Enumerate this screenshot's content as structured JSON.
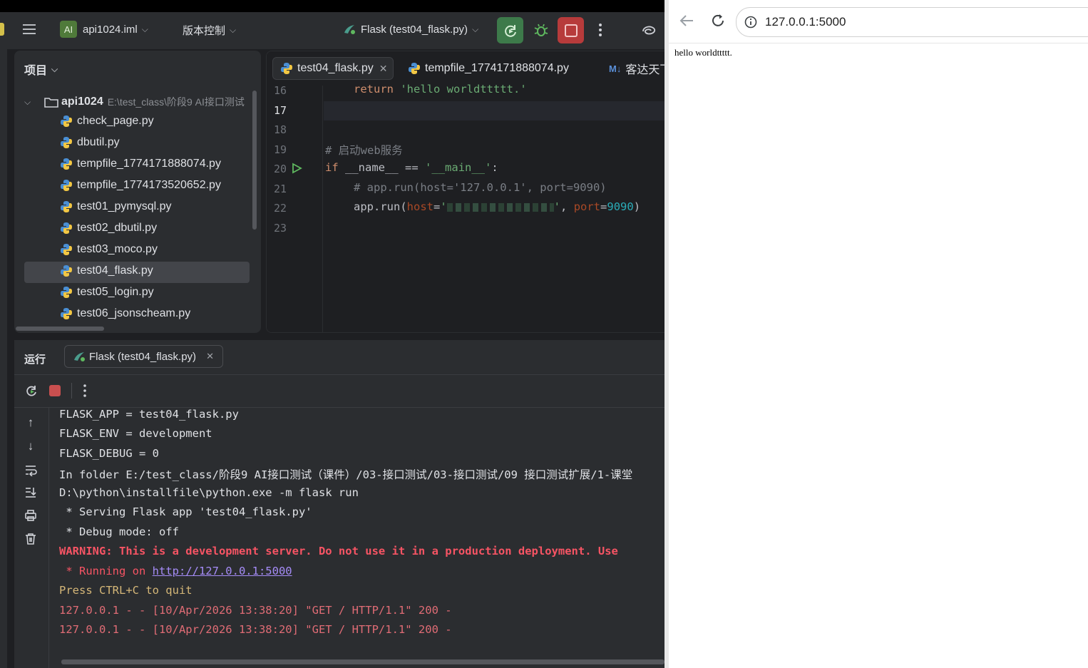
{
  "toolbar": {
    "ai_badge": "AI",
    "project_name": "api1024.iml",
    "vcs_label": "版本控制",
    "run_config": "Flask (test04_flask.py)"
  },
  "project_panel": {
    "title": "项目",
    "root_name": "api1024",
    "root_path": "E:\\test_class\\阶段9 AI接口测试",
    "files": [
      "check_page.py",
      "dbutil.py",
      "tempfile_1774171888074.py",
      "tempfile_1774173520652.py",
      "test01_pymysql.py",
      "test02_dbutil.py",
      "test03_moco.py",
      "test04_flask.py",
      "test05_login.py",
      "test06_jsonscheam.py"
    ],
    "selected_file": "test04_flask.py"
  },
  "editor": {
    "tabs": [
      "test04_flask.py",
      "tempfile_1774171888074.py",
      "客达天下"
    ],
    "tab3_prefix": "M↓",
    "line_numbers": [
      "16",
      "17",
      "18",
      "19",
      "20",
      "21",
      "22",
      "23"
    ],
    "lines": {
      "l16_kw": "return",
      "l16_str": "'hello worldttttt.'",
      "l19": "# 启动web服务",
      "l20_kw": "if",
      "l20_name": "__name__",
      "l20_op": "==",
      "l20_str": "'__main__'",
      "l20_end": ":",
      "l21": "# app.run(host='127.0.0.1', port=9090)",
      "l22_call": "app.run(",
      "l22_host": "host",
      "l22_eq": "=",
      "l22_q": "'",
      "l22_q2": "'",
      "l22_comma": ", ",
      "l22_port": "port",
      "l22_eq2": "=",
      "l22_num": "9090",
      "l22_end": ")"
    }
  },
  "run_panel": {
    "title": "运行",
    "tab_label": "Flask (test04_flask.py)",
    "console": [
      {
        "text": "FLASK_APP = test04_flask.py",
        "kind": "normal"
      },
      {
        "text": "FLASK_ENV = development",
        "kind": "normal"
      },
      {
        "text": "FLASK_DEBUG = 0",
        "kind": "normal"
      },
      {
        "text": "In folder E:/test_class/阶段9 AI接口测试（课件）/03-接口测试/03-接口测试/09 接口测试扩展/1-课堂",
        "kind": "normal"
      },
      {
        "text": "D:\\python\\installfile\\python.exe -m flask run",
        "kind": "normal"
      },
      {
        "text": " * Serving Flask app 'test04_flask.py'",
        "kind": "normal"
      },
      {
        "text": " * Debug mode: off",
        "kind": "normal"
      },
      {
        "text": "WARNING: This is a development server. Do not use it in a production deployment. Use",
        "kind": "warning"
      },
      {
        "text": "Press CTRL+C to quit",
        "kind": "yellow"
      },
      {
        "text": "127.0.0.1 - - [10/Apr/2026 13:38:20] \"GET / HTTP/1.1\" 200 -",
        "kind": "red"
      },
      {
        "text": "127.0.0.1 - - [10/Apr/2026 13:38:20] \"GET / HTTP/1.1\" 200 -",
        "kind": "red"
      }
    ],
    "running_prefix": " * Running on ",
    "running_url": "http://127.0.0.1:5000"
  },
  "browser": {
    "url": "127.0.0.1:5000",
    "page_text": "hello worldttttt."
  },
  "colors": {
    "ide_bg": "#1e1f22",
    "panel_bg": "#2b2d30",
    "warning": "#f75464",
    "red_log": "#e06c75",
    "yellow": "#d5b778",
    "link": "#a58cf7"
  }
}
